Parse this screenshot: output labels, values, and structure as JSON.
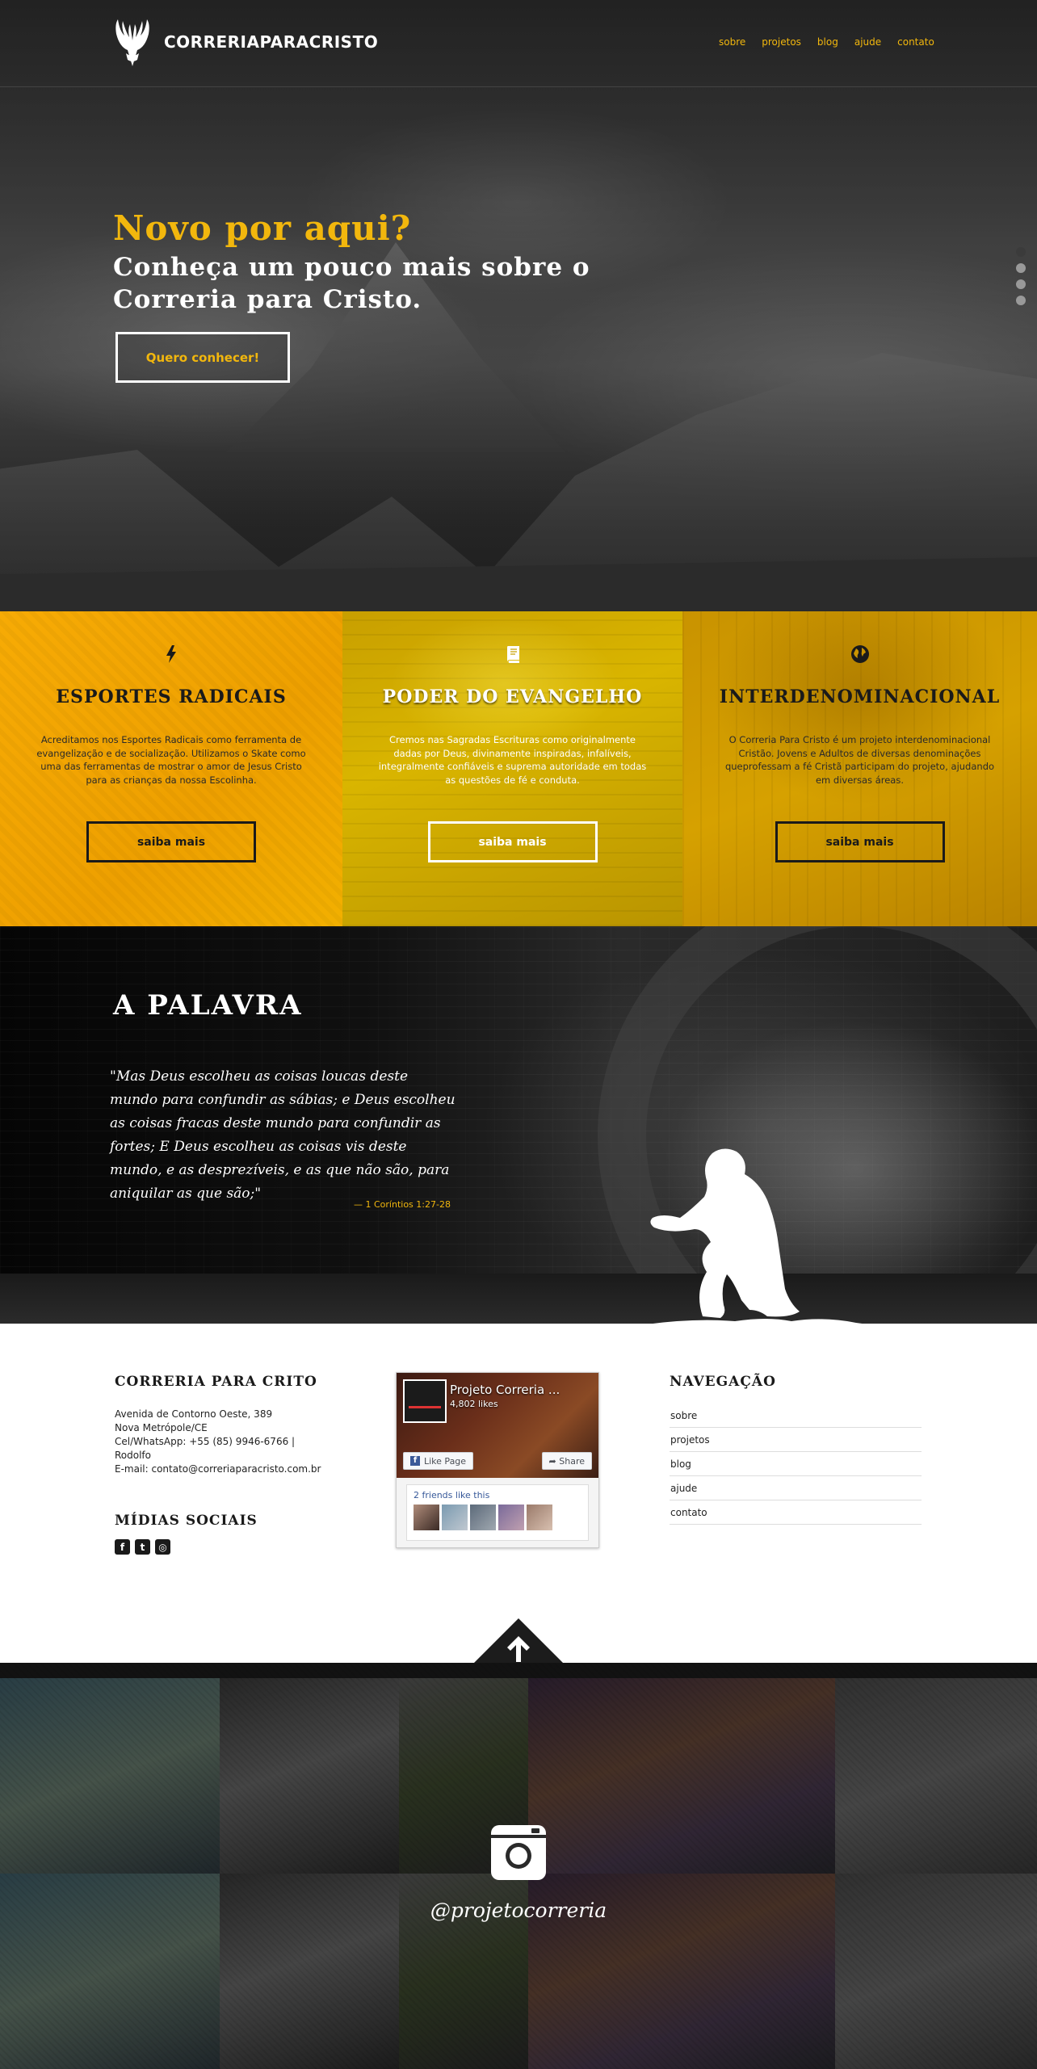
{
  "header": {
    "brand": "CORRERIAPARACRISTO",
    "nav": [
      "sobre",
      "projetos",
      "blog",
      "ajude",
      "contato"
    ]
  },
  "hero": {
    "title": "Novo por aqui?",
    "subtitle": "Conheça um pouco mais sobre o Correria para Cristo.",
    "button": "Quero conhecer!",
    "slide_count": 4,
    "active_slide": 1
  },
  "features": [
    {
      "icon": "lightning-icon",
      "title": "ESPORTES RADICAIS",
      "text": "Acreditamos nos Esportes Radicais como ferramenta de evangelização e de socialização. Utilizamos o Skate como uma das ferramentas de mostrar o amor de Jesus Cristo para as crianças da nossa Escolinha.",
      "button": "saiba mais"
    },
    {
      "icon": "book-icon",
      "title": "PODER DO EVANGELHO",
      "text": "Cremos nas Sagradas Escrituras como originalmente dadas por Deus, divinamente inspiradas, infalíveis, integralmente confiáveis e suprema autoridade em todas as questões de fé e conduta.",
      "button": "saiba mais"
    },
    {
      "icon": "globe-icon",
      "title": "INTERDENOMINACIONAL",
      "text": "O Correria Para Cristo é um projeto interdenominacional Cristão. Jovens e Adultos de diversas denominações queprofessam a fé Cristã participam do projeto, ajudando em diversas áreas.",
      "button": "saiba mais"
    }
  ],
  "palavra": {
    "title": "A PALAVRA",
    "quote": "\"Mas Deus escolheu as coisas loucas deste mundo para confundir as sábias; e Deus escolheu as coisas fracas deste mundo para confundir as fortes; E Deus escolheu as coisas vis deste mundo, e as desprezíveis, e as que não são, para aniquilar as que são;\"",
    "citation": "— 1 Coríntios 1:27-28"
  },
  "footer": {
    "about_title": "CORRERIA PARA CRITO",
    "address": [
      "Avenida de Contorno Oeste, 389",
      "Nova Metrópole/CE",
      "Cel/WhatsApp: +55 (85) 9946-6766 | Rodolfo",
      "E-mail: contato@correriaparacristo.com.br"
    ],
    "social_title": "MÍDIAS SOCIAIS",
    "social_icons": [
      "facebook-icon",
      "twitter-icon",
      "instagram-icon"
    ],
    "facebook_widget": {
      "page_name": "Projeto Correria ...",
      "likes": "4,802 likes",
      "like_button": "Like Page",
      "share_button": "Share",
      "friends": "2 friends like this"
    },
    "nav_title": "NAVEGAÇÃO",
    "nav_items": [
      "sobre",
      "projetos",
      "blog",
      "ajude",
      "contato"
    ]
  },
  "instagram": {
    "handle": "@projetocorreria"
  }
}
